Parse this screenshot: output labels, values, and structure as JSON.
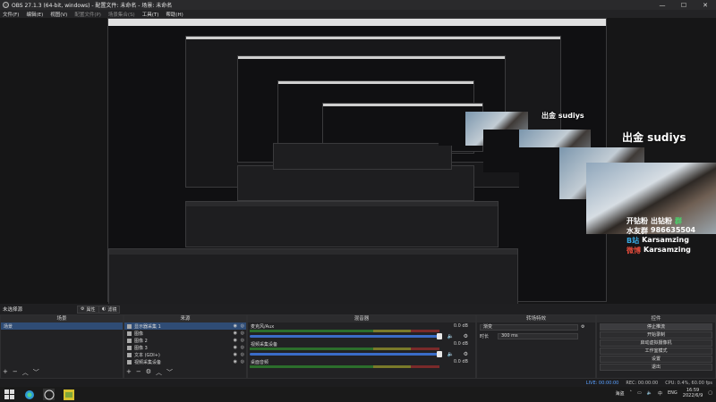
{
  "window": {
    "title": "OBS 27.1.3 (64-bit, windows) - 配置文件: 未命名 - 场景: 未命名",
    "controls": [
      "—",
      "☐",
      "✕"
    ]
  },
  "menu": [
    "文件(F)",
    "编辑(E)",
    "视图(V)",
    "配置文件(P)",
    "场景集合(S)",
    "工具(T)",
    "帮助(H)"
  ],
  "overlay": {
    "title1": "出金  sudiys",
    "line1": "开钻粉",
    "line1b": "出钻粉",
    "group": "群",
    "line2": "水友群",
    "line2v": "986635504",
    "line3": "B站",
    "line3v": "Karsamzing",
    "line4": "微博",
    "line4v": "Karsamzing"
  },
  "scenebar": {
    "current": "未选择源",
    "properties": "属性",
    "filters": "滤镜"
  },
  "docks": {
    "scenes_title": "场景",
    "sources_title": "来源",
    "mixer_title": "混音器",
    "transitions_title": "转场特效",
    "controls_title": "控件"
  },
  "scenes": [
    "场景"
  ],
  "sources": [
    {
      "name": "显示器采集 1",
      "selected": true
    },
    {
      "name": "图像",
      "selected": false
    },
    {
      "name": "图像 2",
      "selected": false
    },
    {
      "name": "图像 3",
      "selected": false
    },
    {
      "name": "文本 (GDI+)",
      "selected": false
    },
    {
      "name": "视频采集设备",
      "selected": false
    }
  ],
  "mixer": [
    {
      "name": "麦克风/Aux",
      "db": "0.0 dB"
    },
    {
      "name": "视频采集设备",
      "db": "0.0 dB"
    },
    {
      "name": "桌面音频",
      "db": "0.0 dB"
    }
  ],
  "transitions": {
    "type": "渐变",
    "duration_label": "时长",
    "duration_value": "300 ms"
  },
  "controls": [
    "停止推流",
    "开始录制",
    "启动虚拟摄像机",
    "工作室模式",
    "设置",
    "退出"
  ],
  "status": {
    "live": "LIVE: 00:00:00",
    "rec": "REC: 00:00:00",
    "cpu": "CPU: 0.4%, 60.00 fps"
  },
  "taskbar": {
    "tray_text": "海盗",
    "lang": "ENG",
    "time": "16:59",
    "date": "2022/6/9"
  },
  "colors": {
    "accent": "#2f4c75",
    "meter_green": "#2c6e2c",
    "fader": "#3a6cc7"
  }
}
